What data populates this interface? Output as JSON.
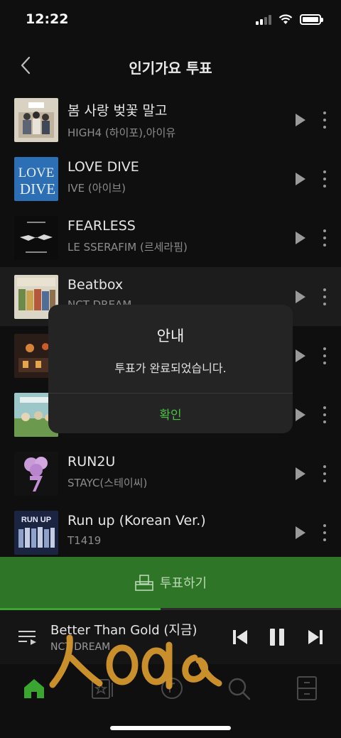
{
  "status_bar": {
    "time": "12:22"
  },
  "header": {
    "title": "인기가요 투표"
  },
  "songs": [
    {
      "title": "봄 사랑 벚꽃 말고",
      "artist": "HIGH4 (하이포),아이유"
    },
    {
      "title": "LOVE DIVE",
      "artist": "IVE (아이브)"
    },
    {
      "title": "FEARLESS",
      "artist": "LE SSERAFIM (르세라핌)"
    },
    {
      "title": "Beatbox",
      "artist": "NCT DREAM"
    },
    {
      "title": "",
      "artist": ""
    },
    {
      "title": "",
      "artist": ""
    },
    {
      "title": "RUN2U",
      "artist": "STAYC(스테이씨)"
    },
    {
      "title": "Run up (Korean Ver.)",
      "artist": "T1419"
    }
  ],
  "vote_bar": {
    "label": "투표하기"
  },
  "mini_player": {
    "title": "Better Than Gold (지금)",
    "artist": "NCT DREAM",
    "progress": 0.47
  },
  "dialog": {
    "title": "안내",
    "message": "투표가 완료되었습니다.",
    "confirm": "확인"
  },
  "tabs": [
    {
      "icon": "home-icon",
      "active": true
    },
    {
      "icon": "star-card-icon"
    },
    {
      "icon": "music-icon"
    },
    {
      "icon": "search-icon"
    },
    {
      "icon": "storage-icon"
    }
  ],
  "colors": {
    "accent": "#3aa631",
    "vote_bar": "#2f7527",
    "background": "#0f0f0f",
    "dialog": "#242424"
  }
}
